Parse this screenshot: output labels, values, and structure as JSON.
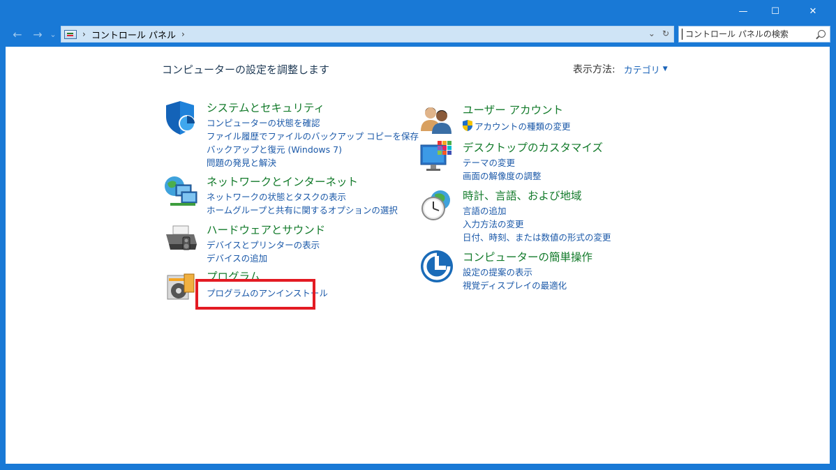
{
  "window": {
    "minimize_glyph": "—",
    "maximize_glyph": "☐",
    "close_glyph": "✕"
  },
  "nav": {
    "back_glyph": "←",
    "forward_glyph": "→",
    "recent_glyph": "⌄",
    "breadcrumb_separator": "›",
    "location": "コントロール パネル",
    "dropdown_glyph": "⌄",
    "refresh_glyph": "↻"
  },
  "search": {
    "placeholder": "コントロール パネルの検索"
  },
  "main": {
    "title": "コンピューターの設定を調整します",
    "view_by_label": "表示方法:",
    "view_by_value": "カテゴリ",
    "view_by_caret": "▼"
  },
  "categories_left": [
    {
      "icon": "shield-icon",
      "title": "システムとセキュリティ",
      "links": [
        "コンピューターの状態を確認",
        "ファイル履歴でファイルのバックアップ コピーを保存",
        "バックアップと復元 (Windows 7)",
        "問題の発見と解決"
      ]
    },
    {
      "icon": "network-icon",
      "title": "ネットワークとインターネット",
      "links": [
        "ネットワークの状態とタスクの表示",
        "ホームグループと共有に関するオプションの選択"
      ]
    },
    {
      "icon": "printer-icon",
      "title": "ハードウェアとサウンド",
      "links": [
        "デバイスとプリンターの表示",
        "デバイスの追加"
      ]
    },
    {
      "icon": "programs-icon",
      "title": "プログラム",
      "links": [
        "プログラムのアンインストール"
      ]
    }
  ],
  "categories_right": [
    {
      "icon": "users-icon",
      "title": "ユーザー アカウント",
      "links": [
        "アカウントの種類の変更"
      ]
    },
    {
      "icon": "desktop-icon",
      "title": "デスクトップのカスタマイズ",
      "links": [
        "テーマの変更",
        "画面の解像度の調整"
      ]
    },
    {
      "icon": "clock-globe-icon",
      "title": "時計、言語、および地域",
      "links": [
        "言語の追加",
        "入力方法の変更",
        "日付、時刻、または数値の形式の変更"
      ]
    },
    {
      "icon": "ease-of-access-icon",
      "title": "コンピューターの簡単操作",
      "links": [
        "設定の提案の表示",
        "視覚ディスプレイの最適化"
      ]
    }
  ],
  "colors": {
    "frame": "#1979d6",
    "category_title": "#127a2a",
    "link": "#1a58a8",
    "highlight": "#e31b23"
  }
}
